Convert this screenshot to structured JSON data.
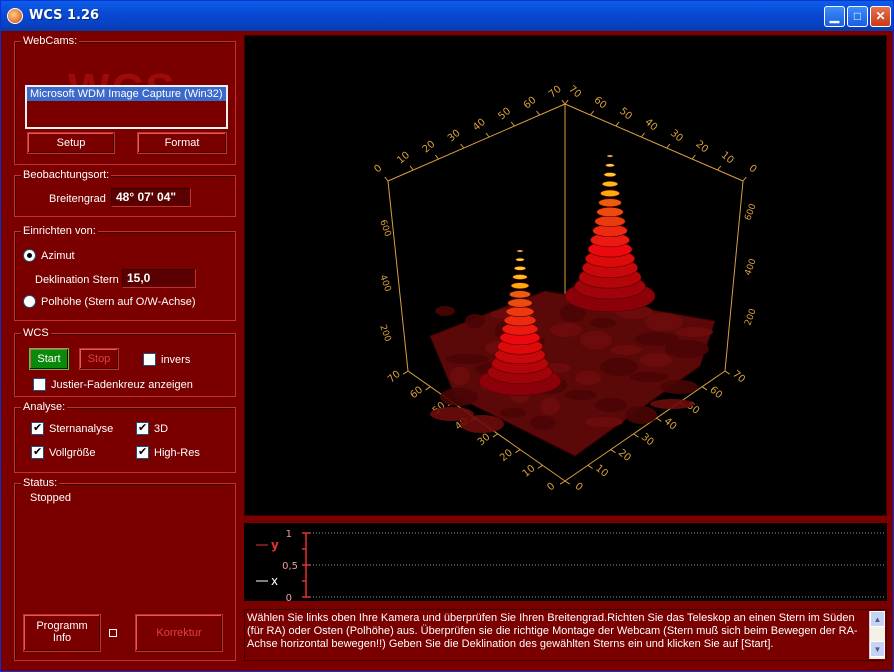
{
  "window": {
    "title": "WCS 1.26"
  },
  "webcams": {
    "group_label": "WebCams:",
    "watermark": "WCS",
    "devices": [
      "Microsoft WDM Image Capture (Win32)"
    ],
    "setup_label": "Setup",
    "format_label": "Format"
  },
  "location": {
    "group_label": "Beobachtungsort:",
    "latitude_label": "Breitengrad",
    "latitude_value": "48° 07' 04\""
  },
  "setup_from": {
    "group_label": "Einrichten von:",
    "azimuth_label": "Azimut",
    "declination_label": "Deklination Stern",
    "declination_value": "15,0",
    "polar_label": "Polhöhe (Stern auf O/W-Achse)",
    "selected": "azimut"
  },
  "wcs": {
    "group_label": "WCS",
    "start_label": "Start",
    "stop_label": "Stop",
    "invers_label": "invers",
    "invers_checked": false,
    "crosshair_label": "Justier-Fadenkreuz anzeigen",
    "crosshair_checked": false
  },
  "analysis": {
    "group_label": "Analyse:",
    "star_analysis_label": "Sternanalyse",
    "star_analysis_checked": true,
    "three_d_label": "3D",
    "three_d_checked": true,
    "full_size_label": "Vollgröße",
    "full_size_checked": true,
    "high_res_label": "High-Res",
    "high_res_checked": true
  },
  "status": {
    "group_label": "Status:",
    "value": "Stopped"
  },
  "footer": {
    "program_info_line1": "Programm",
    "program_info_line2": "Info",
    "correction_label": "Korrektur"
  },
  "plot3d": {
    "axis_left_ticks": [
      "0",
      "10",
      "20",
      "30",
      "40",
      "50",
      "60",
      "70"
    ],
    "axis_right_ticks": [
      "70",
      "60",
      "50",
      "40",
      "30",
      "20",
      "10",
      "0"
    ],
    "bottom_left_ticks": [
      "70",
      "60",
      "50",
      "40",
      "30",
      "20",
      "10",
      "0"
    ],
    "bottom_right_ticks": [
      "0",
      "10",
      "20",
      "30",
      "40",
      "50",
      "60",
      "70"
    ],
    "vertical_ticks": [
      "600",
      "400",
      "200"
    ],
    "axis_color": "#d8a040"
  },
  "graph": {
    "legend_y": "y",
    "legend_x": "x",
    "y_color": "#e83030",
    "x_color": "#ffffff",
    "ticks": [
      "1",
      "0,5",
      "0"
    ]
  },
  "info": {
    "text": "Wählen Sie links oben Ihre Kamera und überprüfen Sie Ihren Breitengrad.Richten Sie das Teleskop an einen Stern im Süden (für RA) oder Osten (Polhöhe) aus. Überprüfen sie die richtige Montage der Webcam (Stern muß sich beim Bewegen der RA-Achse horizontal bewegen!!) Geben Sie die Deklination des gewählten Sterns ein und klicken Sie auf [Start]."
  }
}
